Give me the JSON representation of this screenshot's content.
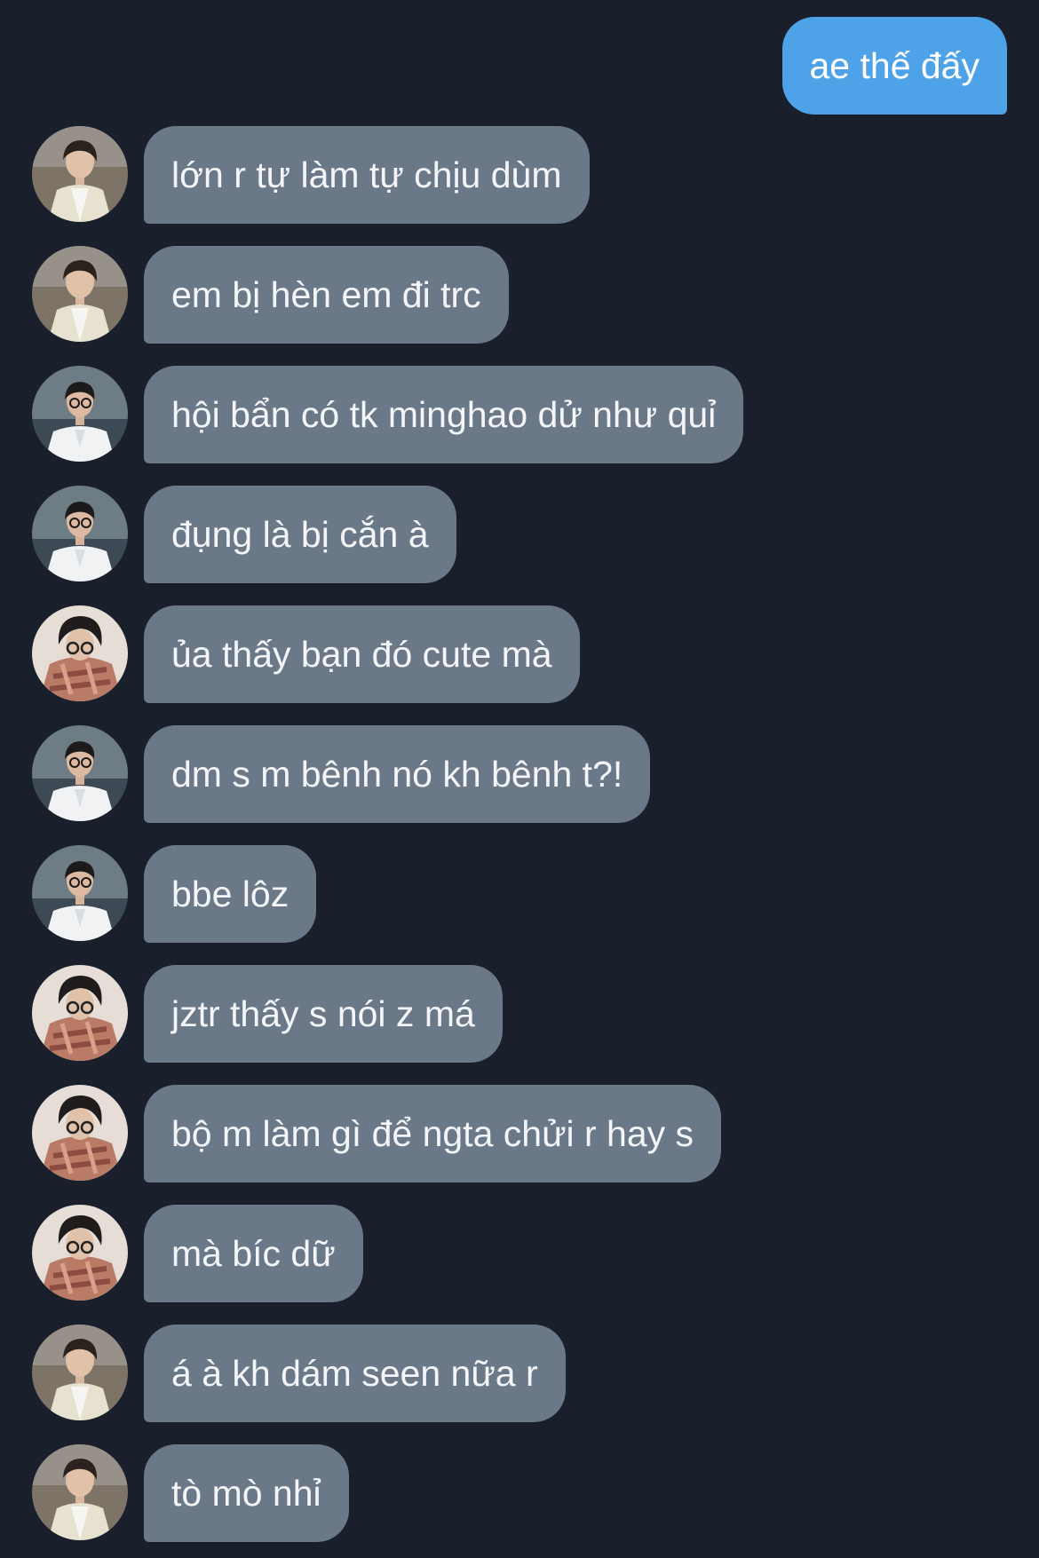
{
  "outgoing": {
    "text": "ae thế đấy"
  },
  "messages": [
    {
      "text": "lớn r tự làm tự chịu dùm",
      "avatar": "avatar-cardigan"
    },
    {
      "text": "em bị hèn em đi trc",
      "avatar": "avatar-cardigan"
    },
    {
      "text": "hội bẩn có tk minghao dử như quỉ",
      "avatar": "avatar-white-shirt"
    },
    {
      "text": "đụng là bị cắn à",
      "avatar": "avatar-white-shirt"
    },
    {
      "text": "ủa thấy bạn đó cute mà",
      "avatar": "avatar-plaid-scarf"
    },
    {
      "text": "dm s m bênh nó kh bênh t?!",
      "avatar": "avatar-white-shirt"
    },
    {
      "text": "bbe lôz",
      "avatar": "avatar-white-shirt"
    },
    {
      "text": "jztr thấy s nói z má",
      "avatar": "avatar-plaid-scarf"
    },
    {
      "text": "bộ m làm gì để ngta chửi r hay s",
      "avatar": "avatar-plaid-scarf"
    },
    {
      "text": "mà bíc dữ",
      "avatar": "avatar-plaid-scarf"
    },
    {
      "text": "á à kh dám seen nữa r",
      "avatar": "avatar-cardigan"
    },
    {
      "text": "tò mò nhỉ",
      "avatar": "avatar-cardigan"
    }
  ],
  "colors": {
    "background": "#19202b",
    "outgoing_bubble": "#4ea3e8",
    "incoming_bubble": "#6b7888"
  }
}
